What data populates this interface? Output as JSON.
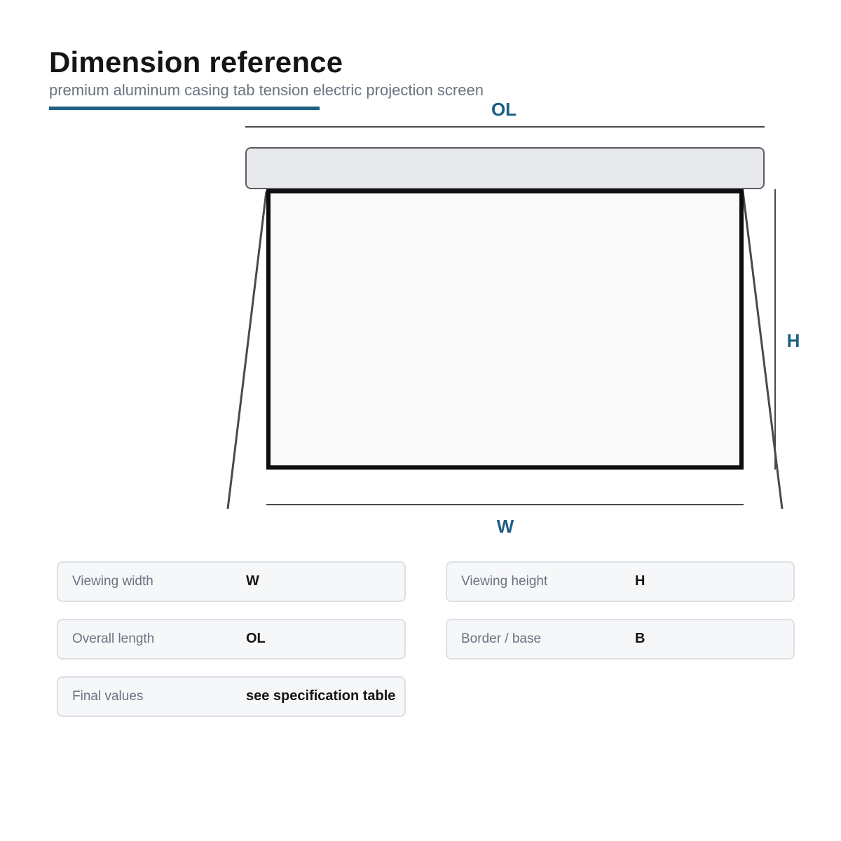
{
  "header": {
    "title": "Dimension reference",
    "subtitle": "premium aluminum casing tab tension electric projection screen"
  },
  "diagram": {
    "labels": {
      "overall_length": "OL",
      "height": "H",
      "width": "W"
    },
    "colors": {
      "accent": "#1f5f86",
      "casing_fill": "#e8e9ed",
      "casing_stroke": "#5b5d62",
      "screen_fill": "#f9f9f9",
      "screen_border": "#0d0d0d",
      "guide_line": "#4a4a4a"
    }
  },
  "specs": [
    {
      "label": "Viewing width",
      "value": "W"
    },
    {
      "label": "Viewing height",
      "value": "H"
    },
    {
      "label": "Overall length",
      "value": "OL"
    },
    {
      "label": "Border / base",
      "value": "B"
    },
    {
      "label": "Final values",
      "value": "see specification table"
    }
  ]
}
